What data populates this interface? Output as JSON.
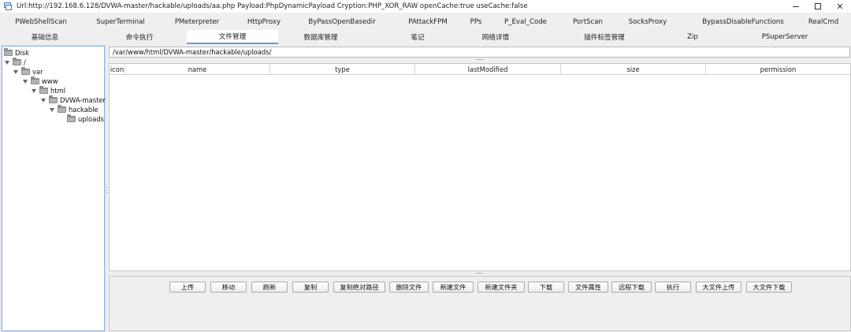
{
  "window": {
    "title": "Url:http://192.168.6.128/DVWA-master/hackable/uploads/aa.php Payload:PhpDynamicPayload Cryption:PHP_XOR_RAW openCache:true useCache:false",
    "minimize_icon": "minimize-icon",
    "maximize_icon": "maximize-icon",
    "close_glyph": "✕"
  },
  "plugin_tabs": [
    "PWebShellScan",
    "SuperTerminal",
    "PMeterpreter",
    "HttpProxy",
    "ByPassOpenBasedir",
    "PAttackFPM",
    "PPs",
    "P_Eval_Code",
    "PortScan",
    "SocksProxy",
    "BypassDisableFunctions",
    "RealCmd"
  ],
  "main_tabs": [
    "基础信息",
    "命令执行",
    "文件管理",
    "数据库管理",
    "笔记",
    "网络详情",
    "插件标签管理",
    "Zip",
    "PSuperServer"
  ],
  "active_main_tab": "文件管理",
  "tree": [
    {
      "label": "Disk",
      "level": 0,
      "expanded": false,
      "has_toggle": false
    },
    {
      "label": "/",
      "level": 1,
      "expanded": true,
      "has_toggle": true
    },
    {
      "label": "var",
      "level": 2,
      "expanded": true,
      "has_toggle": true
    },
    {
      "label": "www",
      "level": 3,
      "expanded": true,
      "has_toggle": true
    },
    {
      "label": "html",
      "level": 4,
      "expanded": true,
      "has_toggle": true
    },
    {
      "label": "DVWA-master",
      "level": 5,
      "expanded": true,
      "has_toggle": true
    },
    {
      "label": "hackable",
      "level": 6,
      "expanded": true,
      "has_toggle": true
    },
    {
      "label": "uploads",
      "level": 7,
      "expanded": false,
      "has_toggle": false
    }
  ],
  "path": "/var/www/html/DVWA-master/hackable/uploads/",
  "table_columns": [
    "icon",
    "name",
    "type",
    "lastModified",
    "size",
    "permission"
  ],
  "action_buttons": [
    "上传",
    "移动",
    "刷新",
    "复制",
    "复制绝对路径",
    "删除文件",
    "新建文件",
    "新建文件夹",
    "下载",
    "文件属性",
    "远程下载",
    "执行",
    "大文件上传",
    "大文件下载"
  ],
  "colors": {
    "active_tab_underline": "#6a9ad3",
    "tree_border": "#8fb3e0",
    "panel_bg": "#efefef"
  }
}
